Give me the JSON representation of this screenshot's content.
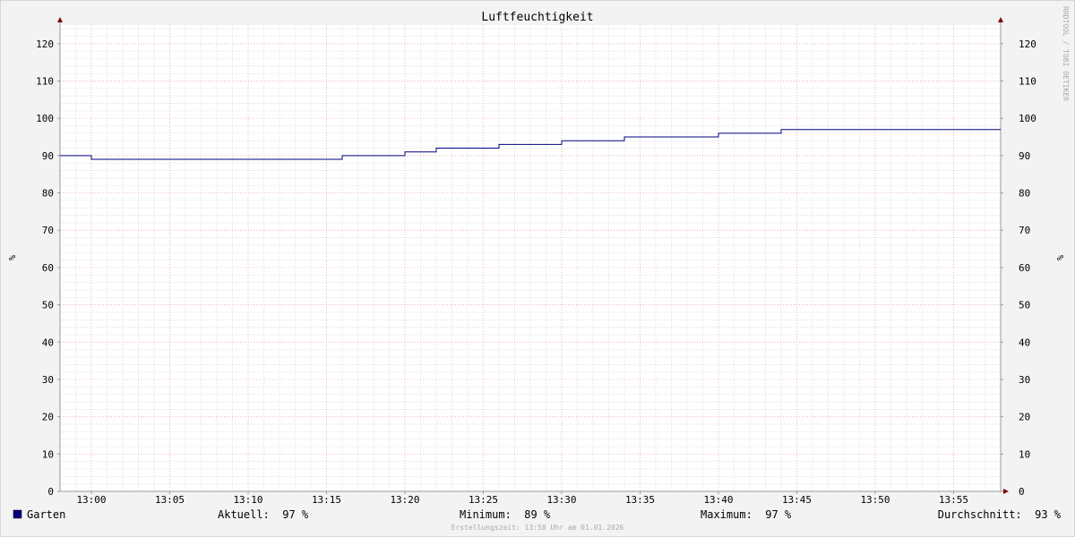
{
  "chart_data": {
    "type": "line",
    "title": "Luftfeuchtigkeit",
    "ylabel": "%",
    "ylim": [
      0,
      125
    ],
    "y_ticks": [
      0,
      10,
      20,
      30,
      40,
      50,
      60,
      70,
      80,
      90,
      100,
      110,
      120
    ],
    "x_range": [
      "12:58",
      "13:58"
    ],
    "x_ticks": [
      "13:00",
      "13:05",
      "13:10",
      "13:15",
      "13:20",
      "13:25",
      "13:30",
      "13:35",
      "13:40",
      "13:45",
      "13:50",
      "13:55"
    ],
    "grid": true,
    "series": [
      {
        "name": "Garten",
        "color": "#000080",
        "step": true,
        "points": [
          {
            "x": "12:58",
            "y": 90
          },
          {
            "x": "13:00",
            "y": 89
          },
          {
            "x": "13:16",
            "y": 90
          },
          {
            "x": "13:20",
            "y": 91
          },
          {
            "x": "13:22",
            "y": 92
          },
          {
            "x": "13:26",
            "y": 93
          },
          {
            "x": "13:30",
            "y": 94
          },
          {
            "x": "13:34",
            "y": 95
          },
          {
            "x": "13:40",
            "y": 96
          },
          {
            "x": "13:44",
            "y": 97
          },
          {
            "x": "13:58",
            "y": 97
          }
        ]
      }
    ]
  },
  "legend": {
    "series_name": "Garten",
    "swatch_color": "#000080",
    "aktuell": "Aktuell:  97 %",
    "minimum": "Minimum:  89 %",
    "maximum": "Maximum:  97 %",
    "durchschnitt": "Durchschnitt:  93 %"
  },
  "watermark": "RRDTOOL / TOBI OETIKER",
  "footer": "Erstellungszeit: 13:58 Uhr am 01.01.2026"
}
